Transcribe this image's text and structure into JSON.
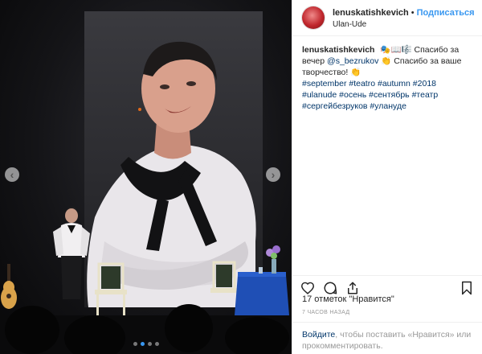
{
  "post": {
    "username": "lenuskatishkevich",
    "separator": "•",
    "follow_label": "Подписаться",
    "location": "Ulan-Ude",
    "caption_text": "🎭📖🎼 Спасибо за вечер",
    "mention": "@s_bezrukov",
    "caption_text_2": "👏 Спасибо за ваше творчество! 👏",
    "hashtags": [
      "#september",
      "#teatro",
      "#autumn",
      "#2018",
      "#ulanude",
      "#осень",
      "#сентябрь",
      "#театр",
      "#сергейбезруков",
      "#улануде"
    ],
    "likes": "17 отметок \"Нравится\"",
    "time": "7 ЧАСОВ НАЗАД",
    "login_prompt_link": "Войдите",
    "login_prompt_rest": ", чтобы поставить «Нравится» или прокомментировать."
  },
  "media": {
    "slide_count": 4,
    "active_slide": 2,
    "prev_label": "‹",
    "next_label": "›"
  },
  "icons": {
    "like": "heart-icon",
    "comment": "comment-icon",
    "share": "share-icon",
    "save": "bookmark-icon"
  },
  "colors": {
    "link": "#3897f0",
    "hashtag": "#003569",
    "text": "#262626",
    "muted": "#999999"
  }
}
